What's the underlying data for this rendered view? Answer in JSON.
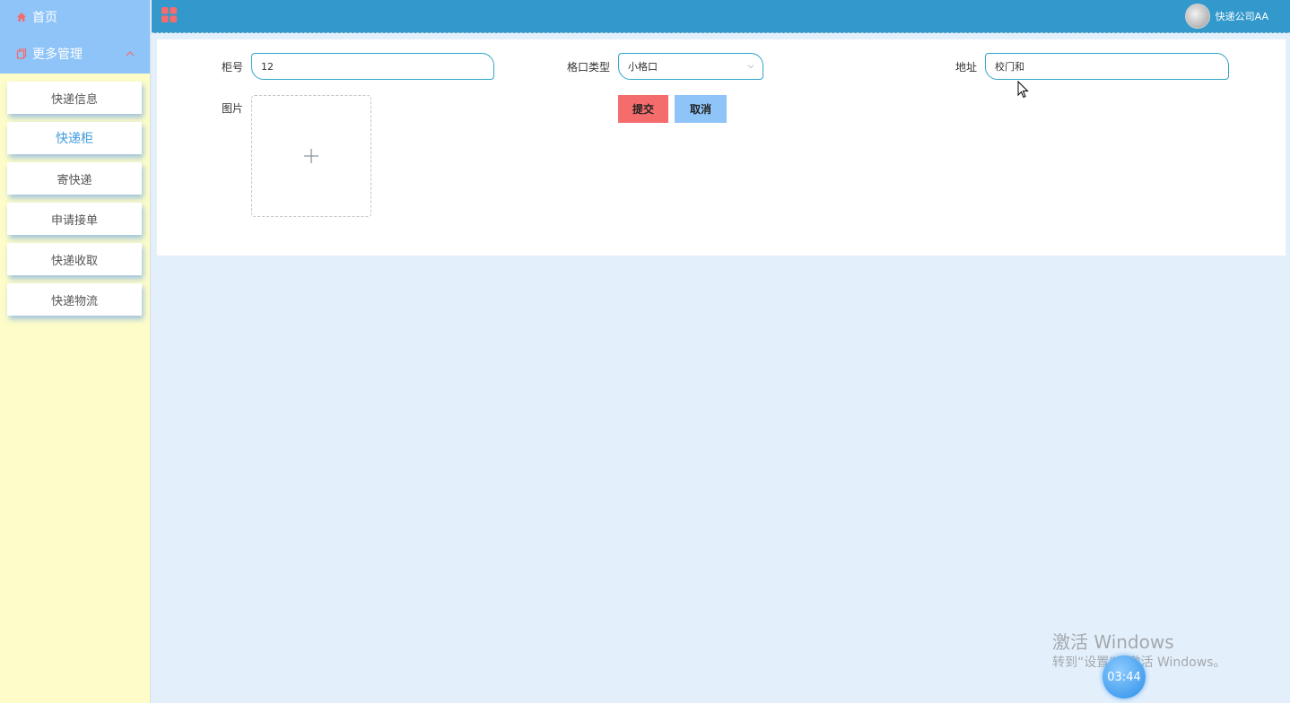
{
  "sidebar": {
    "home_label": "首页",
    "more_label": "更多管理",
    "items": [
      {
        "label": "快递信息"
      },
      {
        "label": "快递柜"
      },
      {
        "label": "寄快递"
      },
      {
        "label": "申请接单"
      },
      {
        "label": "快递收取"
      },
      {
        "label": "快递物流"
      }
    ],
    "active_item": "快递柜"
  },
  "header": {
    "username": "快递公司AA"
  },
  "form": {
    "cabinet_label": "柜号",
    "cabinet_value": "12",
    "slot_type_label": "格口类型",
    "slot_type_value": "小格口",
    "address_label": "地址",
    "address_value": "校门和",
    "image_label": "图片",
    "submit_label": "提交",
    "cancel_label": "取消"
  },
  "watermark": {
    "title": "激活 Windows",
    "subtitle": "转到“设置”以激活 Windows。"
  },
  "clock": "03:44",
  "colors": {
    "sidebar_bg": "#fefdc9",
    "nav_header_bg": "#8ec4f8",
    "topbar_bg": "#3399cc",
    "page_bg": "#e3f0fc",
    "active_item": "#3f9be0",
    "submit_bg": "#f56c6c",
    "cancel_bg": "#8ec4f8",
    "input_border": "#2fa4c8"
  }
}
